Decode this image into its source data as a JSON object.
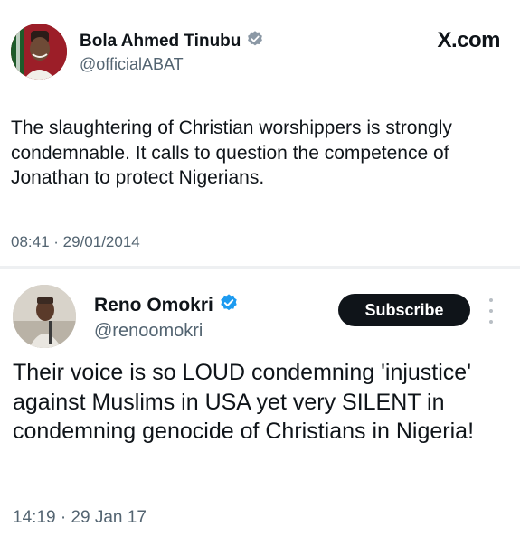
{
  "tweet1": {
    "display_name": "Bola Ahmed Tinubu",
    "handle": "@officialABAT",
    "verified_icon": "gray-verified-badge-icon",
    "source_label": "X.com",
    "text": "The slaughtering of Christian worshippers is strongly condemnable. It calls to question the competence of Jonathan to protect Nigerians.",
    "timestamp": "08:41 · 29/01/2014",
    "badge_color": "#8b98a5"
  },
  "tweet2": {
    "display_name": "Reno Omokri",
    "handle": "@renoomokri",
    "verified_icon": "blue-verified-badge-icon",
    "subscribe_label": "Subscribe",
    "more_icon": "vertical-ellipsis-icon",
    "text": "Their voice is so LOUD condemning 'injustice' against Muslims in USA yet very SILENT in condemning genocide of Christians in Nigeria!",
    "timestamp": "14:19 · 29 Jan 17",
    "badge_color": "#1d9bf0"
  }
}
